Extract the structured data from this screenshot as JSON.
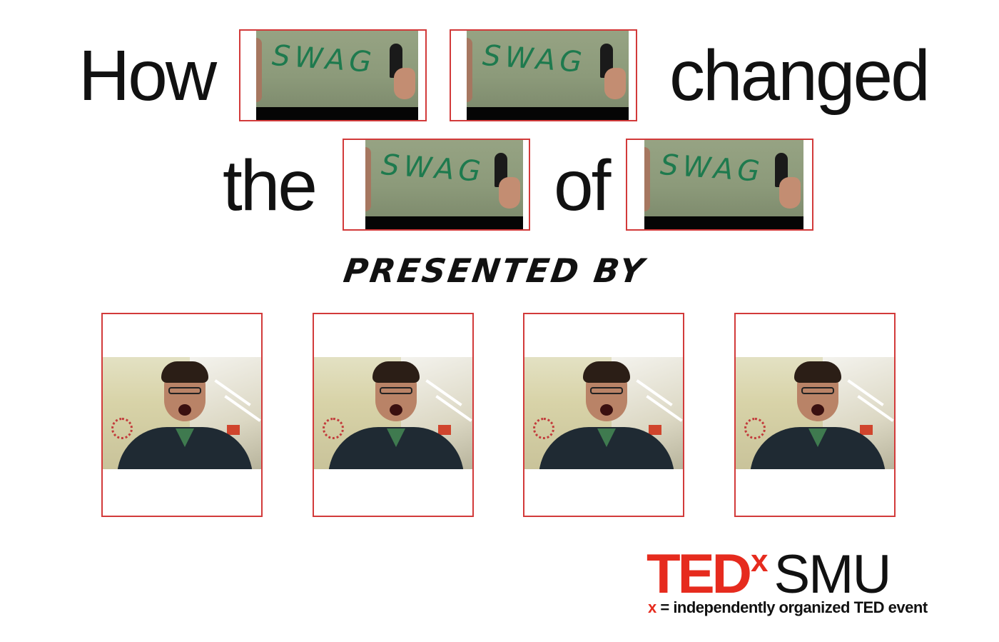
{
  "title": {
    "line1": [
      "How",
      "changed"
    ],
    "line2": [
      "the",
      "of"
    ],
    "placeholder_word": "SWAG"
  },
  "presented_by": "PRESENTED BY",
  "presenters": [
    {
      "label": "presenter-1"
    },
    {
      "label": "presenter-2"
    },
    {
      "label": "presenter-3"
    },
    {
      "label": "presenter-4"
    }
  ],
  "logo": {
    "ted": "TED",
    "x": "x",
    "name": "SMU",
    "tagline_x": "x",
    "tagline_rest": " = independently organized TED event"
  },
  "colors": {
    "frame_red": "#d23a3a",
    "ted_red": "#e62b1e",
    "swag_green": "#1e7a4e"
  }
}
